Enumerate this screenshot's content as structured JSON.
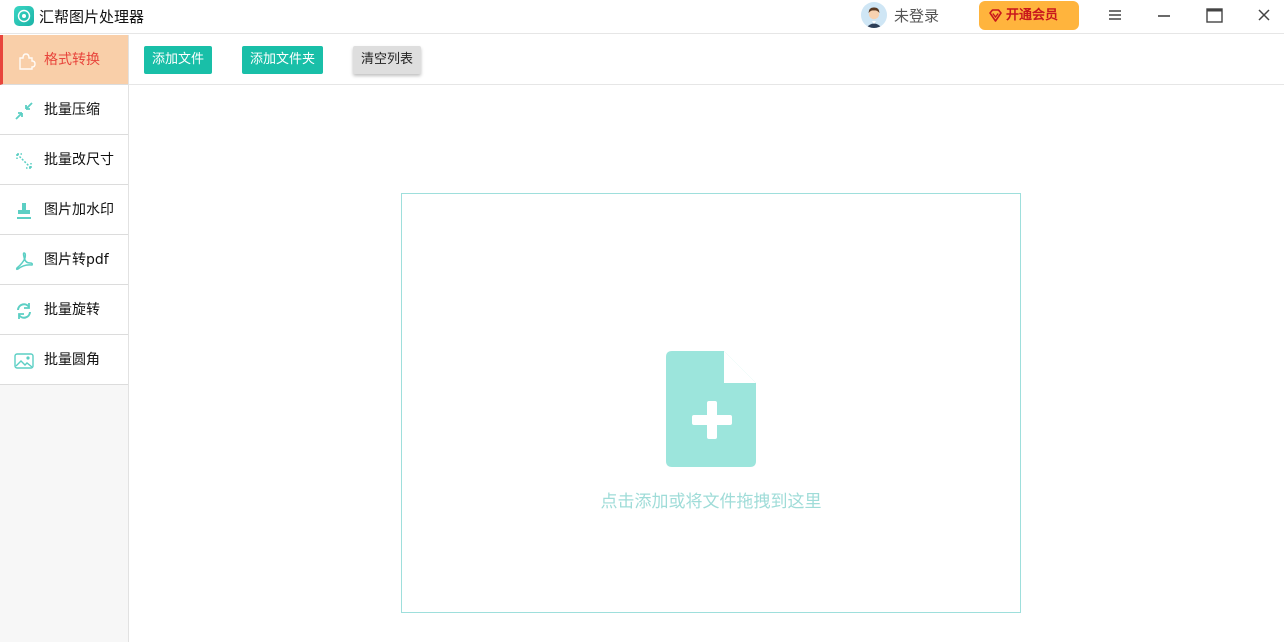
{
  "window": {
    "title": "汇帮图片处理器",
    "user_status": "未登录",
    "vip_label": "开通会员"
  },
  "sidebar": {
    "items": [
      {
        "label": "格式转换",
        "icon": "puzzle-icon",
        "active": true
      },
      {
        "label": "批量压缩",
        "icon": "compress-icon",
        "active": false
      },
      {
        "label": "批量改尺寸",
        "icon": "resize-icon",
        "active": false
      },
      {
        "label": "图片加水印",
        "icon": "stamp-icon",
        "active": false
      },
      {
        "label": "图片转pdf",
        "icon": "pdf-icon",
        "active": false
      },
      {
        "label": "批量旋转",
        "icon": "rotate-icon",
        "active": false
      },
      {
        "label": "批量圆角",
        "icon": "image-corner-icon",
        "active": false
      }
    ]
  },
  "toolbar": {
    "add_file": "添加文件",
    "add_folder": "添加文件夹",
    "clear_list": "清空列表"
  },
  "dropzone": {
    "hint": "点击添加或将文件拖拽到这里"
  },
  "colors": {
    "accent": "#19bfa8",
    "active_bg": "#f9cfa9",
    "active_text": "#e8453c",
    "vip_bg": "#ffb43d",
    "dropzone_icon": "#9ce5dc"
  }
}
